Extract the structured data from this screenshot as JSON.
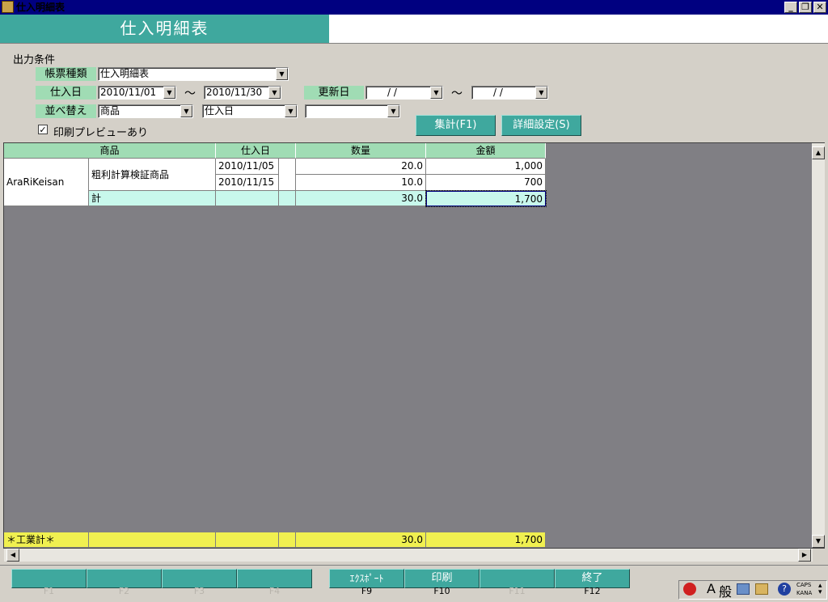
{
  "window": {
    "title": "仕入明細表",
    "min": "_",
    "restore": "❐",
    "close": "✕"
  },
  "header": {
    "title": "仕入明細表"
  },
  "conditions": {
    "section_label": "出力条件",
    "form_type_label": "帳票種類",
    "form_type_value": "仕入明細表",
    "purchase_date_label": "仕入日",
    "purchase_date_from": "2010/11/01",
    "purchase_date_to": "2010/11/30",
    "tilde": "〜",
    "update_date_label": "更新日",
    "update_date_from": "  /  /",
    "update_date_to": "  /  /",
    "sort_label": "並べ替え",
    "sort1": "商品",
    "sort2": "仕入日",
    "sort3": "",
    "preview_label": "印刷プレビューあり",
    "preview_checked": true,
    "aggregate_button": "集計(F1)",
    "detail_button": "詳細設定(S)"
  },
  "grid": {
    "columns": [
      "商品",
      "仕入日",
      "数量",
      "金額"
    ],
    "group": "AraRiKeisan",
    "product": "粗利計算検証商品",
    "rows": [
      {
        "date": "2010/11/05",
        "qty": "20.0",
        "amount": "1,000"
      },
      {
        "date": "2010/11/15",
        "qty": "10.0",
        "amount": "700"
      }
    ],
    "subtotal_label": "計",
    "subtotal_qty": "30.0",
    "subtotal_amount": "1,700",
    "total_label": "＊工業計＊",
    "total_qty": "30.0",
    "total_amount": "1,700"
  },
  "footer": {
    "keys": [
      {
        "label": "",
        "caption": "F1"
      },
      {
        "label": "",
        "caption": "F2"
      },
      {
        "label": "",
        "caption": "F3"
      },
      {
        "label": "",
        "caption": "F4"
      },
      {
        "label": "ｴｸｽﾎﾟｰﾄ",
        "caption": "F9"
      },
      {
        "label": "印刷",
        "caption": "F10"
      },
      {
        "label": "",
        "caption": "F11"
      },
      {
        "label": "終了",
        "caption": "F12"
      }
    ],
    "ime": {
      "a": "A",
      "mode": "般",
      "caps": "CAPS",
      "kana": "KANA"
    }
  },
  "colors": {
    "accent": "#3fa89e",
    "label_green": "#a0dcb4",
    "subtotal": "#c8f8ec",
    "total": "#f0f050",
    "grid_bg": "#807f84"
  }
}
